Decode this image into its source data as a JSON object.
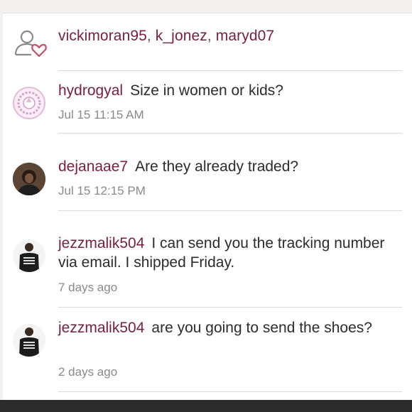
{
  "likes": {
    "users": [
      "vickimoran95",
      "k_jonez",
      "maryd07"
    ]
  },
  "comments": [
    {
      "username": "hydrogyal",
      "text": "Size in women or kids?",
      "time": "Jul 15 11:15 AM",
      "avatar": "unicorn-avatar"
    },
    {
      "username": "dejanaae7",
      "text": "Are they already traded?",
      "time": "Jul 15 12:15 PM",
      "avatar": "person-avatar"
    },
    {
      "username": "jezzmalik504",
      "text": "I can send you the tracking number via email. I shipped Friday.",
      "time": "7 days ago",
      "avatar": "person-shirt-avatar"
    },
    {
      "username": "jezzmalik504",
      "text": "are you going to send the shoes?",
      "time": "2 days ago",
      "avatar": "person-shirt-avatar"
    }
  ],
  "colors": {
    "username": "#7a1f3a",
    "heart": "#c0506a",
    "timestamp": "#8a8a8a",
    "divider": "#dcdcdc"
  }
}
